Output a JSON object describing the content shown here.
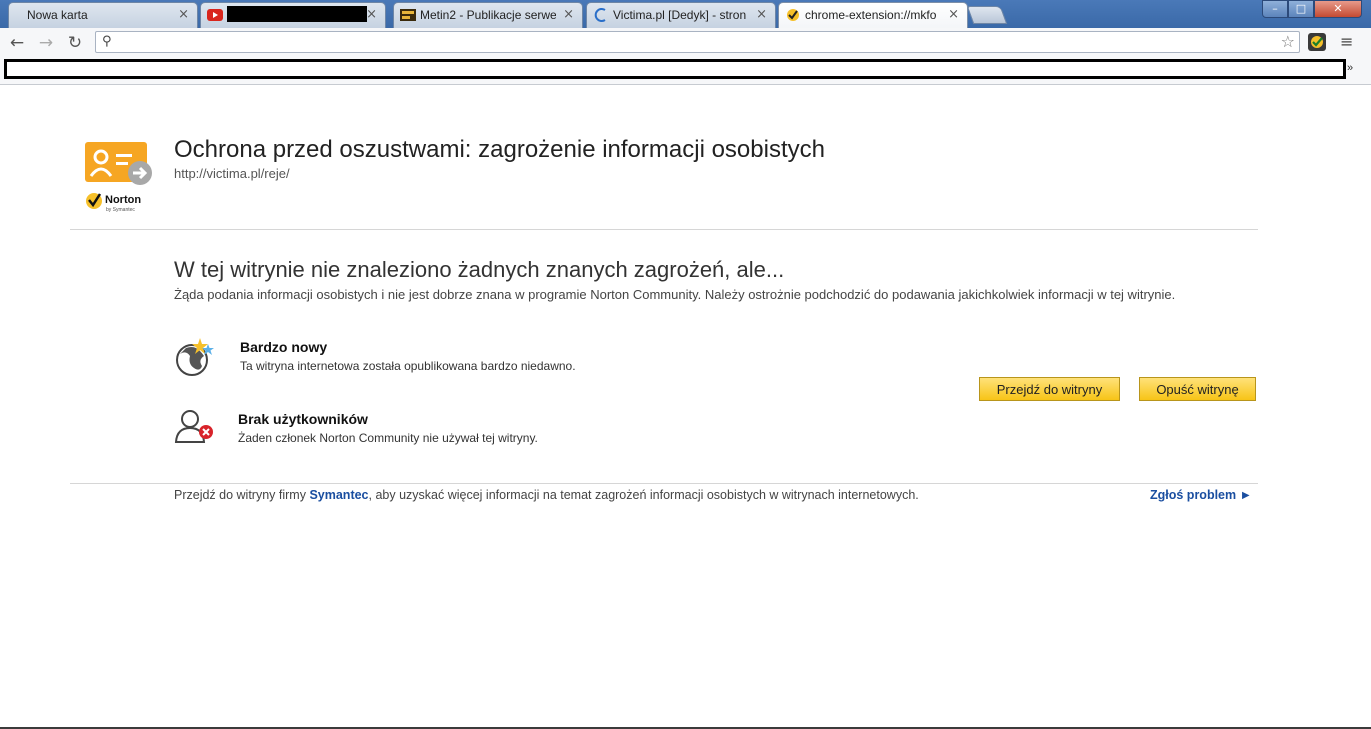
{
  "tabs": [
    {
      "title": "Nowa karta",
      "close": "×"
    },
    {
      "title": "",
      "close": "×",
      "redacted": true
    },
    {
      "title": "Metin2 - Publikacje serwer",
      "close": "×"
    },
    {
      "title": "Victima.pl [Dedyk] - stron",
      "close": "×"
    },
    {
      "title": "chrome-extension://mkfo",
      "close": "×",
      "active": true
    }
  ],
  "window_buttons": {
    "minimize": "–",
    "maximize": "□",
    "close": "✕"
  },
  "toolbar": {
    "back": "←",
    "forward": "→",
    "reload": "↻",
    "search_glyph": "⚲",
    "star": "☆",
    "menu": "≡"
  },
  "bookmarks": {
    "more": "»"
  },
  "page": {
    "title": "Ochrona przed oszustwami: zagrożenie informacji osobistych",
    "url": "http://victima.pl/reje/",
    "logo_text": "Norton",
    "logo_subtext": "by Symantec",
    "headline": "W tej witrynie nie znaleziono żadnych znanych zagrożeń, ale...",
    "description": "Żąda podania informacji osobistych i nie jest dobrze znana w programie Norton Community. Należy ostrożnie podchodzić do podawania jakichkolwiek informacji w tej witrynie.",
    "factors": [
      {
        "title": "Bardzo nowy",
        "desc": "Ta witryna internetowa została opublikowana bardzo niedawno.",
        "icon": "new-site-globe-icon"
      },
      {
        "title": "Brak użytkowników",
        "desc": "Żaden członek Norton Community nie używał tej witryny.",
        "icon": "no-users-icon"
      }
    ],
    "buttons": {
      "proceed": "Przejdź do witryny",
      "leave": "Opuść witrynę"
    },
    "footer": {
      "prefix": "Przejdź do witryny firmy ",
      "brand": "Symantec",
      "suffix": ", aby uzyskać więcej informacji na temat zagrożeń informacji osobistych w witrynach internetowych.",
      "report": "Zgłoś problem ►"
    }
  },
  "colors": {
    "accent_blue": "#1a4ea0",
    "button_yellow": "#f7c417",
    "norton_orange": "#f6a623"
  }
}
